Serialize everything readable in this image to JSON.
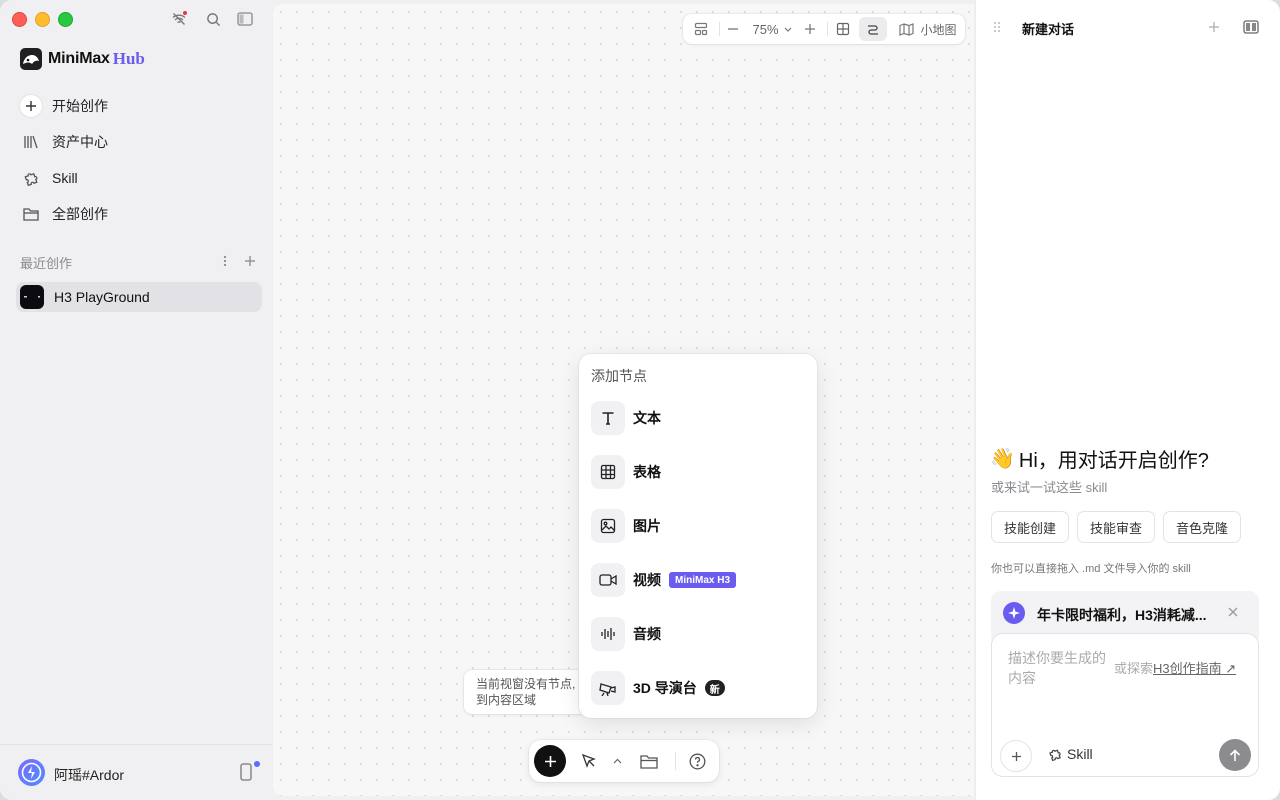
{
  "sidebar": {
    "brand": {
      "name": "MiniMax",
      "suffix": "Hub"
    },
    "nav": [
      {
        "label": "开始创作",
        "icon": "plus-icon"
      },
      {
        "label": "资产中心",
        "icon": "library-icon"
      },
      {
        "label": "Skill",
        "icon": "puzzle-icon"
      },
      {
        "label": "全部创作",
        "icon": "folder-icon"
      }
    ],
    "recent_title": "最近创作",
    "recent_items": [
      {
        "label": "H3 PlayGround"
      }
    ],
    "user": {
      "name": "阿瑶#Ardor"
    }
  },
  "canvas": {
    "toolbar": {
      "zoom": "75%",
      "minimap_label": "小地图"
    },
    "empty_hint_line1": "当前视窗没有节点,",
    "empty_hint_line2": "到内容区域",
    "add_node_menu": {
      "title": "添加节点",
      "items": [
        {
          "label": "文本",
          "icon": "text-icon"
        },
        {
          "label": "表格",
          "icon": "table-icon"
        },
        {
          "label": "图片",
          "icon": "image-icon"
        },
        {
          "label": "视频",
          "icon": "video-icon",
          "badge": "MiniMax H3"
        },
        {
          "label": "音频",
          "icon": "audio-icon"
        },
        {
          "label": "3D 导演台",
          "icon": "camera-3d-icon",
          "badge": "新"
        }
      ]
    }
  },
  "panel": {
    "title": "新建对话",
    "greeting": "Hi，用对话开启创作?",
    "wave": "👋",
    "sub_greeting": "或来试一试这些 skill",
    "skills": [
      "技能创建",
      "技能审查",
      "音色克隆"
    ],
    "drag_hint": "你也可以直接拖入 .md 文件导入你的 skill",
    "promo_text": "年卡限时福利，H3消耗减...",
    "input_placeholder": "描述你要生成的内容",
    "explore_prefix": "或探索",
    "explore_link": "H3创作指南 ↗",
    "skill_label": "Skill"
  },
  "colors": {
    "accent": "#6b5cf0",
    "close": "#ff5f57",
    "minimize": "#febc2e",
    "zoom": "#28c840"
  }
}
